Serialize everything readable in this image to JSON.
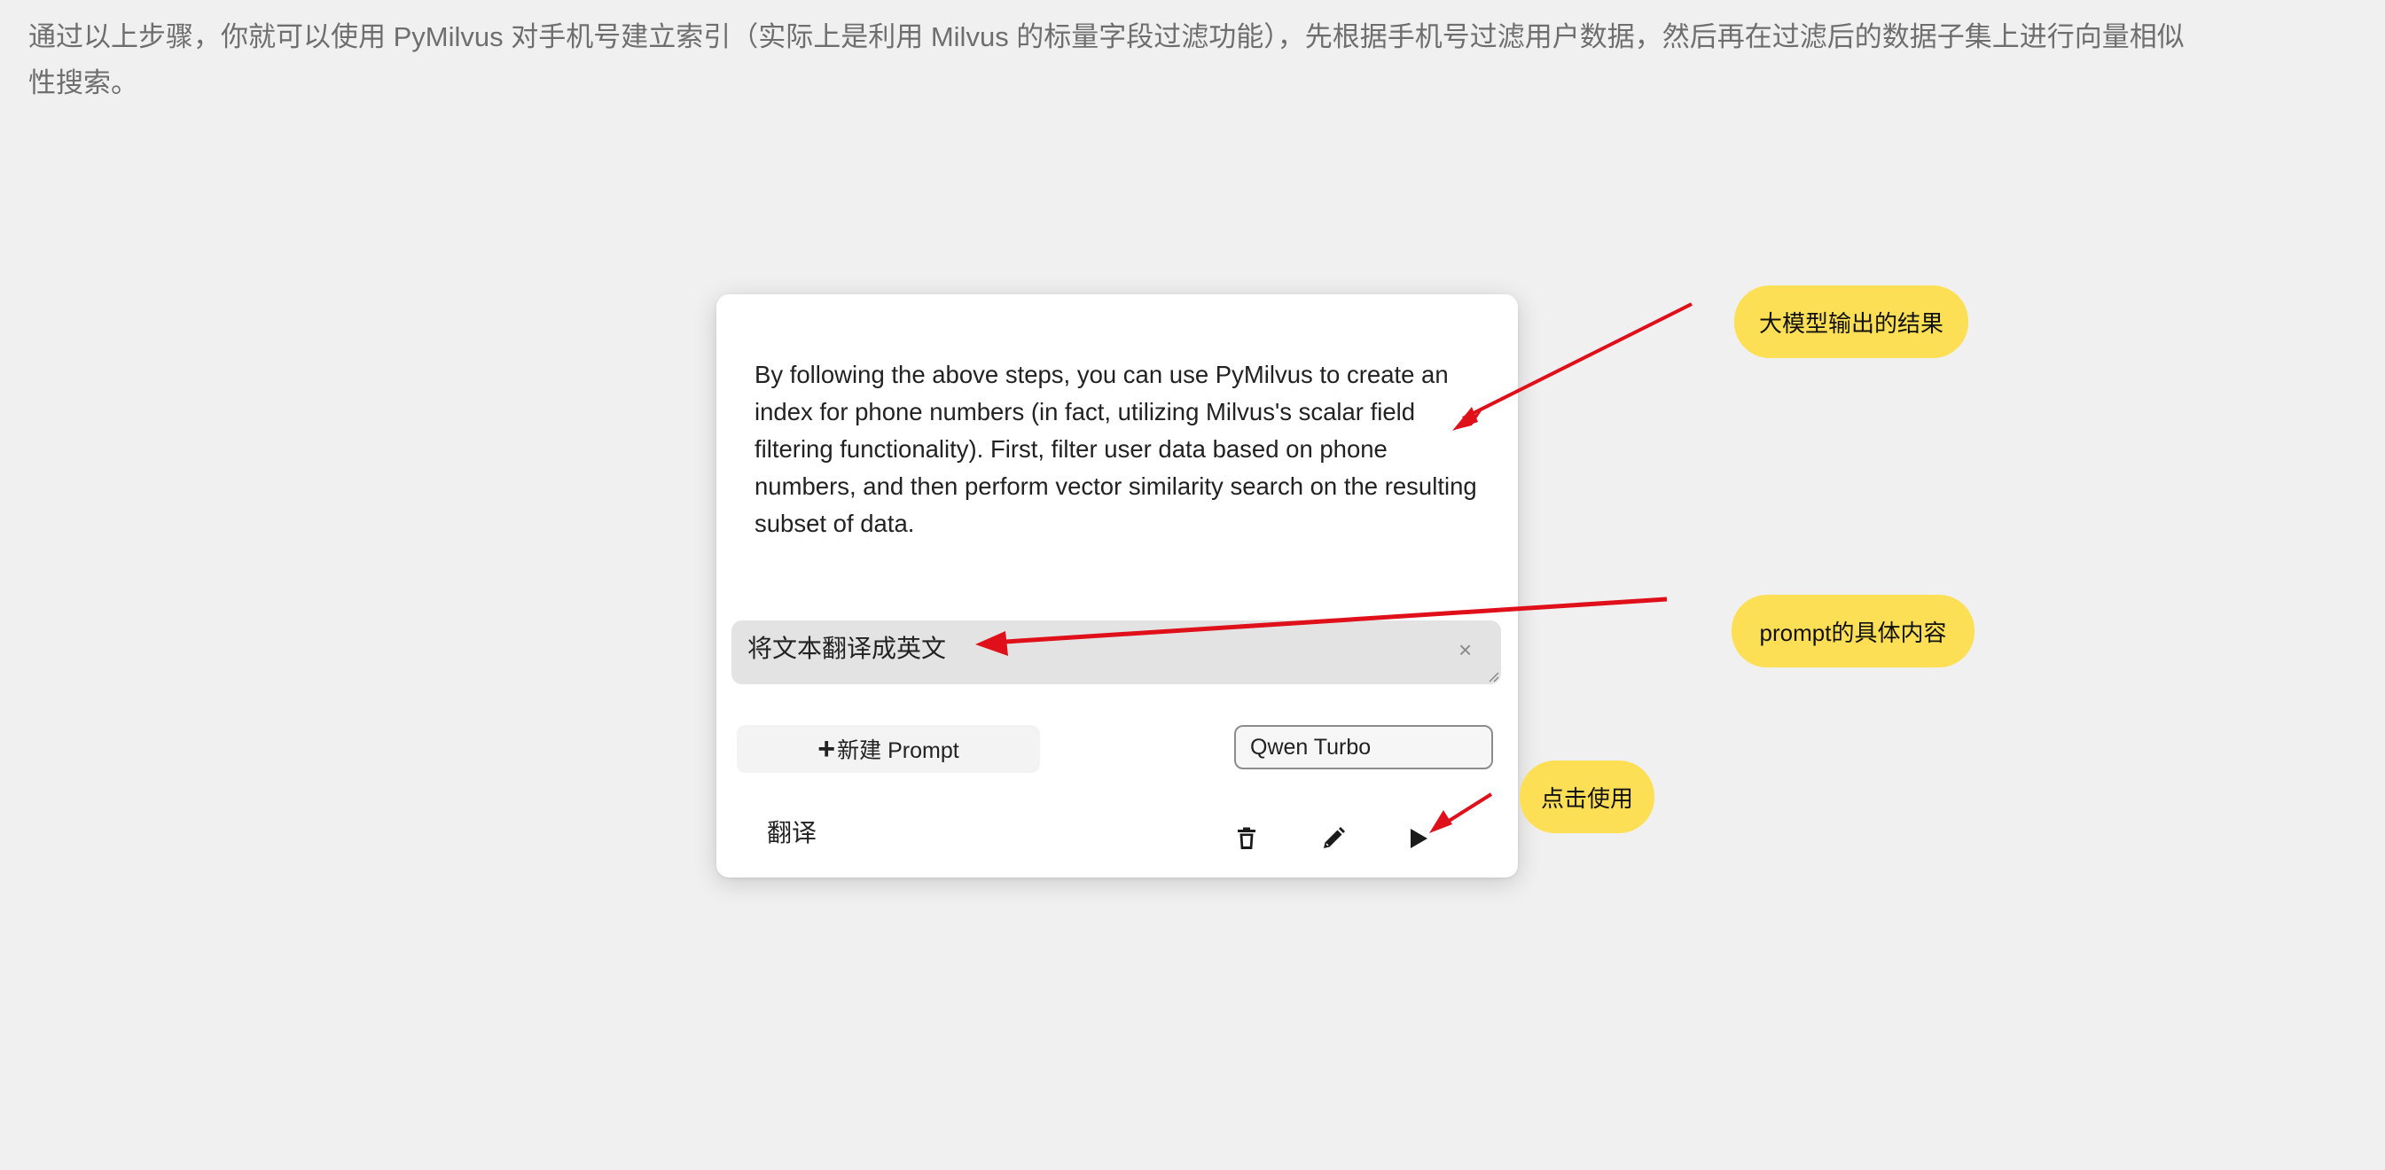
{
  "page": {
    "paragraph": "通过以上步骤，你就可以使用 PyMilvus 对手机号建立索引（实际上是利用 Milvus 的标量字段过滤功能），先根据手机号过滤用户数据，然后再在过滤后的数据子集上进行向量相似性搜索。"
  },
  "panel": {
    "output_text": "By following the above steps, you can use PyMilvus to create an index for phone numbers (in fact, utilizing Milvus's scalar field filtering functionality). First, filter user data based on phone numbers, and then perform vector similarity search on the resulting subset of data.",
    "prompt_input_value": "将文本翻译成英文",
    "clear_label": "×",
    "new_prompt_label": "新建 Prompt",
    "model_selected": "Qwen Turbo",
    "prompt_item_name": "翻译",
    "icons": [
      "trash-icon",
      "pencil-icon",
      "play-icon"
    ]
  },
  "annotations": {
    "output_callout": "大模型输出的结果",
    "prompt_callout": "prompt的具体内容",
    "use_callout": "点击使用",
    "callout_color": "#fddf56",
    "arrow_color": "#e0101a"
  }
}
